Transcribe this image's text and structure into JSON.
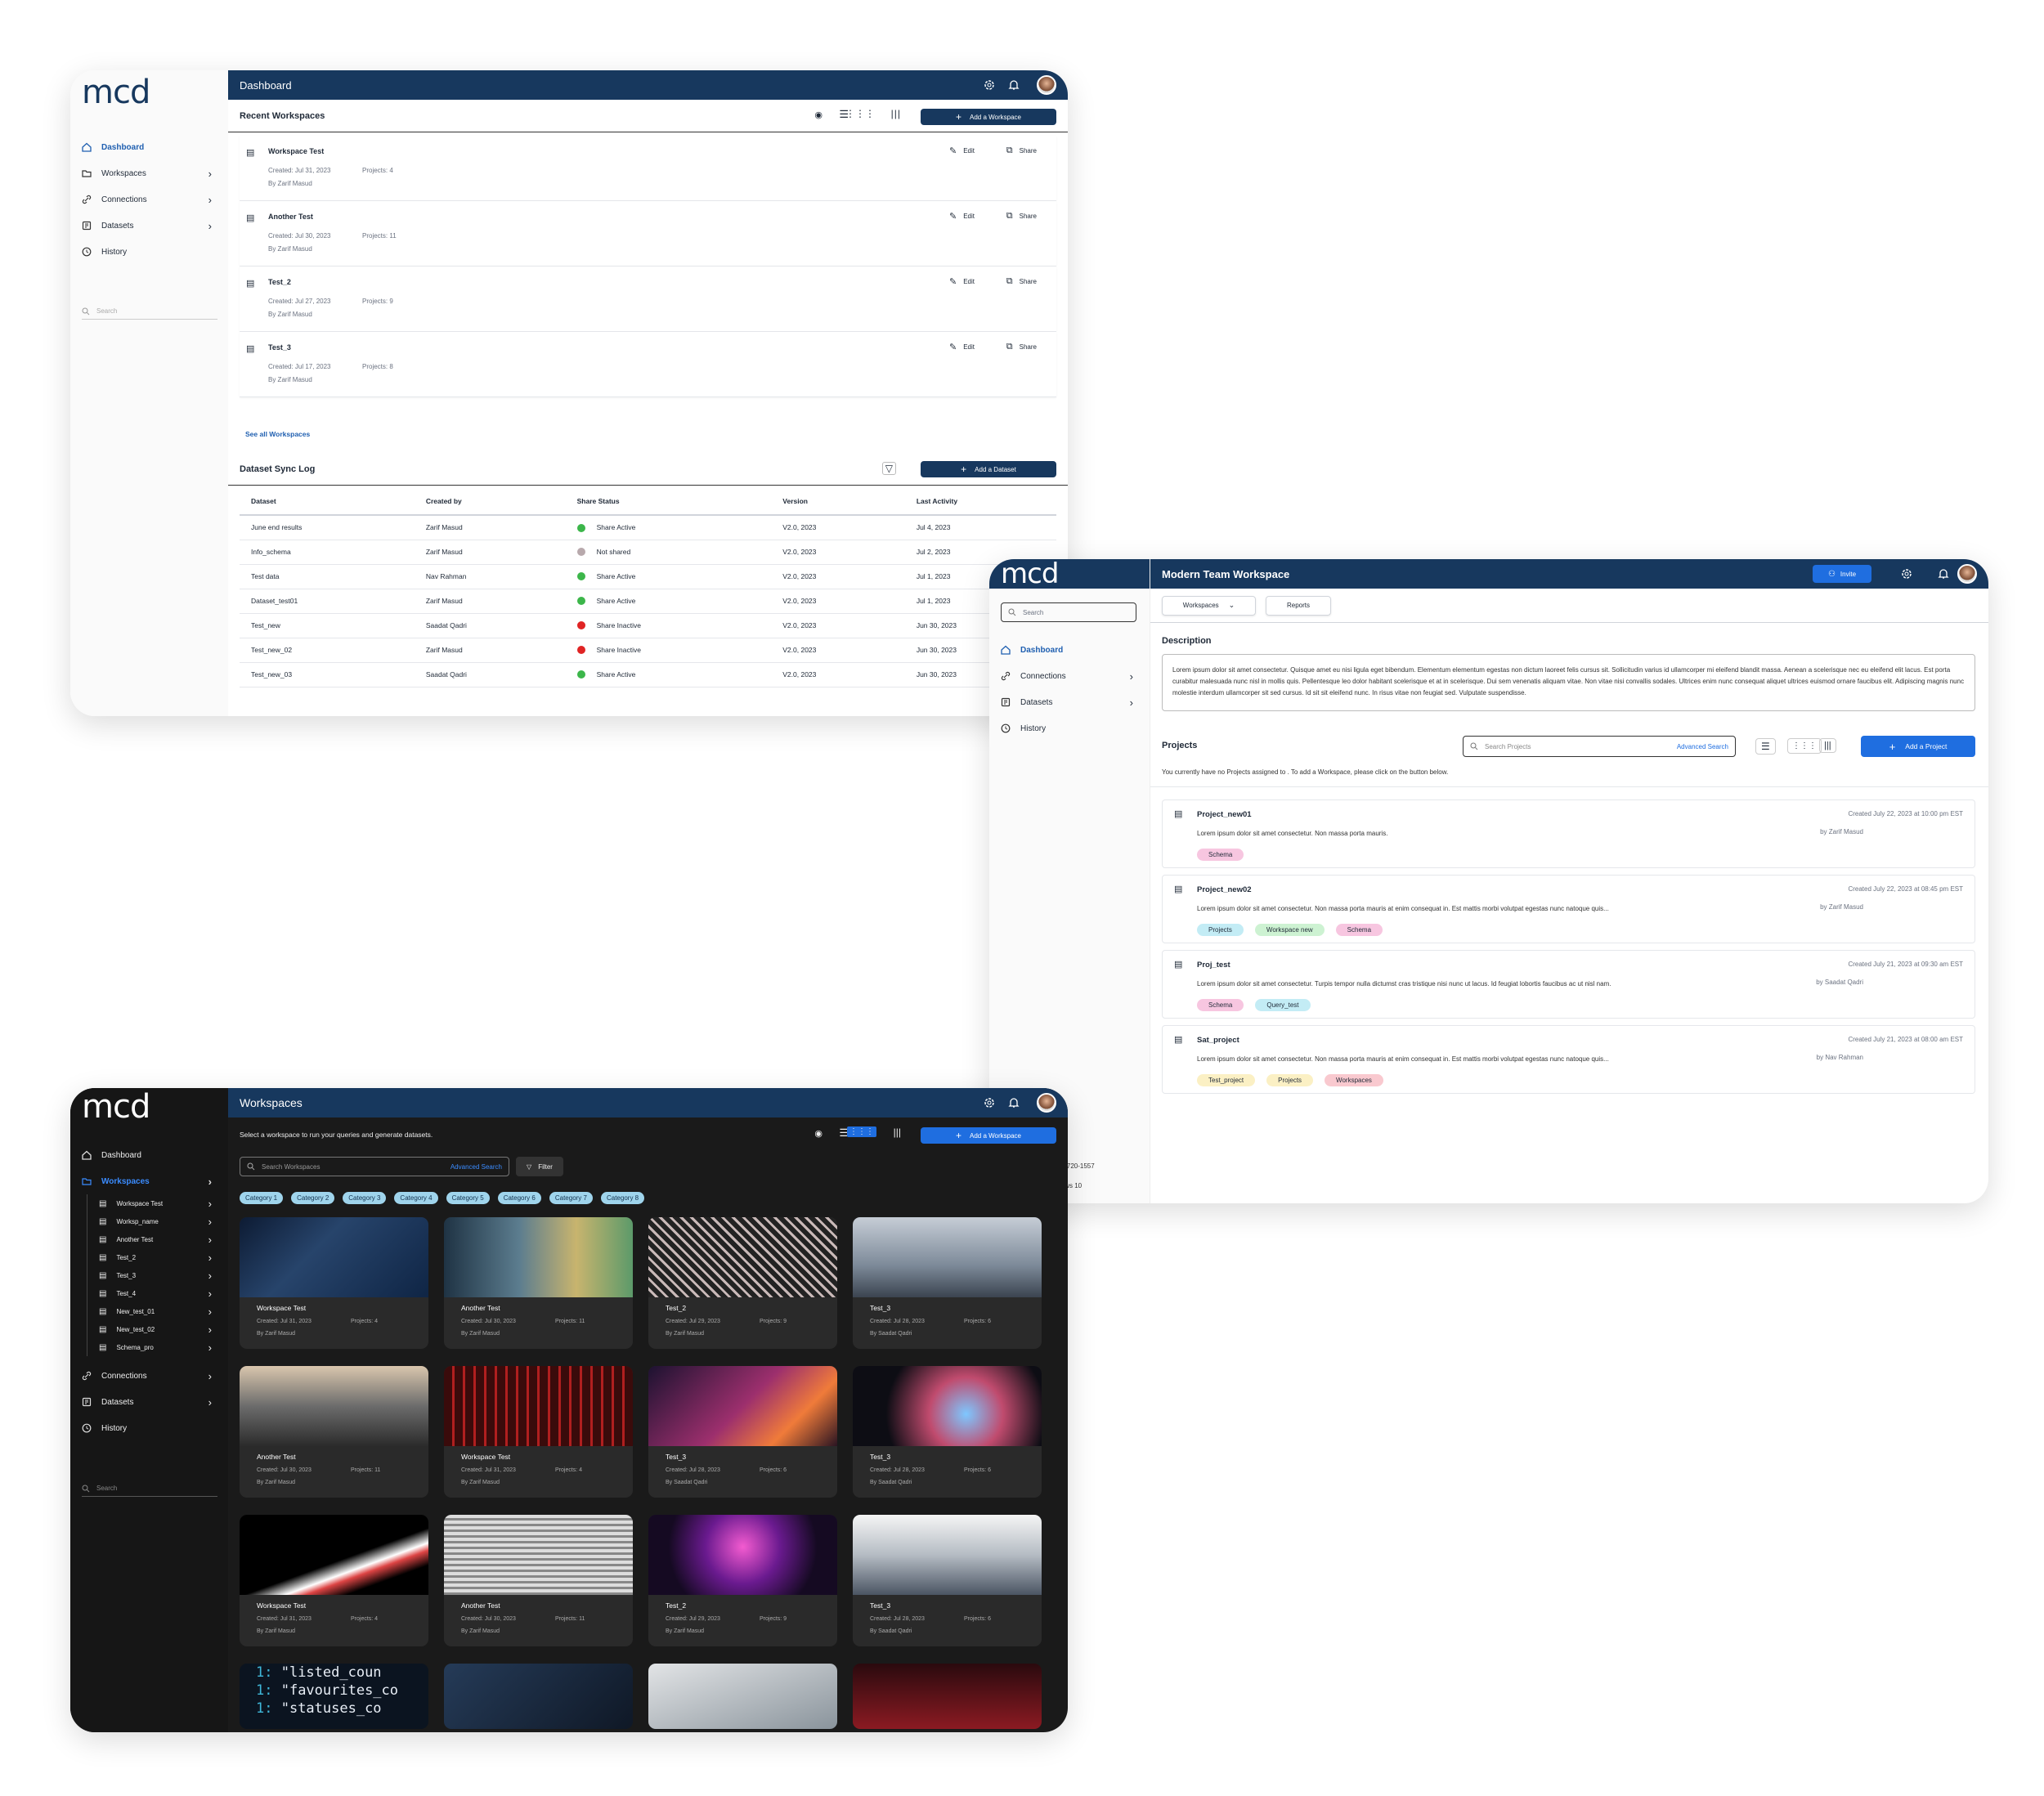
{
  "brand": {
    "logo": "mcd"
  },
  "w1": {
    "title": "Dashboard",
    "nav": [
      {
        "label": "Dashboard"
      },
      {
        "label": "Workspaces"
      },
      {
        "label": "Connections"
      },
      {
        "label": "Datasets"
      },
      {
        "label": "History"
      }
    ],
    "search_placeholder": "Search",
    "recent_title": "Recent Workspaces",
    "add_workspace": "Add a Workspace",
    "edit": "Edit",
    "share": "Share",
    "workspaces": [
      {
        "name": "Workspace Test",
        "created": "Created: Jul 31, 2023",
        "projects": "Projects: 4",
        "by": "By Zarif Masud"
      },
      {
        "name": "Another Test",
        "created": "Created: Jul 30, 2023",
        "projects": "Projects: 11",
        "by": "By Zarif Masud"
      },
      {
        "name": "Test_2",
        "created": "Created: Jul 27, 2023",
        "projects": "Projects: 9",
        "by": "By Zarif Masud"
      },
      {
        "name": "Test_3",
        "created": "Created: Jul 17, 2023",
        "projects": "Projects: 8",
        "by": "By Zarif Masud"
      }
    ],
    "see_all": "See all Workspaces",
    "sync_title": "Dataset Sync Log",
    "add_dataset": "Add a Dataset",
    "columns": [
      "Dataset",
      "Created by",
      "Share Status",
      "Version",
      "Last Activity"
    ],
    "rows": [
      {
        "dataset": "June end results",
        "by": "Zarif Masud",
        "status": "Share Active",
        "color": "#3cb64a",
        "version": "V2.0, 2023",
        "activity": "Jul 4, 2023"
      },
      {
        "dataset": "Info_schema",
        "by": "Zarif Masud",
        "status": "Not shared",
        "color": "#b8a9ac",
        "version": "V2.0, 2023",
        "activity": "Jul 2, 2023"
      },
      {
        "dataset": "Test data",
        "by": "Nav Rahman",
        "status": "Share Active",
        "color": "#3cb64a",
        "version": "V2.0, 2023",
        "activity": "Jul 1, 2023"
      },
      {
        "dataset": "Dataset_test01",
        "by": "Zarif Masud",
        "status": "Share Active",
        "color": "#3cb64a",
        "version": "V2.0, 2023",
        "activity": "Jul 1, 2023"
      },
      {
        "dataset": "Test_new",
        "by": "Saadat Qadri",
        "status": "Share Inactive",
        "color": "#e02424",
        "version": "V2.0, 2023",
        "activity": "Jun 30, 2023"
      },
      {
        "dataset": "Test_new_02",
        "by": "Zarif Masud",
        "status": "Share Inactive",
        "color": "#e02424",
        "version": "V2.0, 2023",
        "activity": "Jun 30, 2023"
      },
      {
        "dataset": "Test_new_03",
        "by": "Saadat Qadri",
        "status": "Share Active",
        "color": "#3cb64a",
        "version": "V2.0, 2023",
        "activity": "Jun 30, 2023"
      }
    ]
  },
  "w2": {
    "title": "Modern Team Workspace",
    "invite": "Invite",
    "search_placeholder": "Search",
    "nav": [
      {
        "label": "Dashboard"
      },
      {
        "label": "Connections"
      },
      {
        "label": "Datasets"
      },
      {
        "label": "History"
      }
    ],
    "tabs": [
      "Workspaces",
      "Reports"
    ],
    "description_title": "Description",
    "description": "Lorem ipsum dolor sit amet consectetur. Quisque amet eu nisi ligula eget bibendum. Elementum elementum egestas non dictum laoreet felis cursus sit. Sollicitudin varius id ullamcorper mi eleifend blandit massa. Aenean a scelerisque nec eu eleifend elit lacus. Est porta curabitur malesuada nunc nisl in mollis quis. Pellentesque leo dolor habitant scelerisque et at in scelerisque. Dui sem venenatis aliquam vitae. Non vitae nisi convallis sodales. Ultrices enim nunc consequat aliquet ultrices euismod ornare faucibus elit. Adipiscing magnis nunc molestie interdum ullamcorper sit sed cursus. Id sit sit eleifend nunc. In risus vitae non feugiat sed. Vulputate suspendisse.",
    "projects_title": "Projects",
    "search_projects": "Search Projects",
    "advanced_search": "Advanced Search",
    "add_project": "Add a Project",
    "notice": "You currently have no Projects assigned to . To add a Workspace, please click on the button below.",
    "projects": [
      {
        "name": "Project_new01",
        "desc": "Lorem ipsum dolor sit amet consectetur. Non massa porta mauris.",
        "created": "Created July 22, 2023 at 10:00 pm EST",
        "by": "by Zarif Masud",
        "tags": [
          {
            "t": "Schema",
            "c": "#f7c6e0"
          }
        ]
      },
      {
        "name": "Project_new02",
        "desc": "Lorem ipsum dolor sit amet consectetur. Non massa porta mauris at enim consequat in. Est mattis morbi volutpat egestas nunc natoque quis...",
        "created": "Created July 22, 2023 at 08:45 pm EST",
        "by": "by Zarif Masud",
        "tags": [
          {
            "t": "Projects",
            "c": "#c3ecf5"
          },
          {
            "t": "Workspace new",
            "c": "#cdf2d2"
          },
          {
            "t": "Schema",
            "c": "#f7c6e0"
          }
        ]
      },
      {
        "name": "Proj_test",
        "desc": "Lorem ipsum dolor sit amet consectetur. Turpis tempor nulla dictumst cras tristique nisi nunc ut lacus. Id feugiat lobortis faucibus ac ut nisl nam.",
        "created": "Created July 21, 2023 at 09:30 am EST",
        "by": "by Saadat Qadri",
        "tags": [
          {
            "t": "Schema",
            "c": "#f7c6e0"
          },
          {
            "t": "Query_test",
            "c": "#c3ecf5"
          }
        ]
      },
      {
        "name": "Sat_project",
        "desc": "Lorem ipsum dolor sit amet consectetur. Non massa porta mauris at enim consequat in. Est mattis morbi volutpat egestas nunc natoque quis...",
        "created": "Created July 21, 2023 at 08:00 am EST",
        "by": "by Nav Rahman",
        "tags": [
          {
            "t": "Test_project",
            "c": "#fbf0c4"
          },
          {
            "t": "Projects",
            "c": "#fbf0c4"
          },
          {
            "t": "Workspaces",
            "c": "#f9c9cf"
          }
        ]
      }
    ],
    "peek1": "30720-1557",
    "peek2": "lows 10"
  },
  "w3": {
    "title": "Workspaces",
    "subtitle": "Select a workspace to run your queries and generate datasets.",
    "add_workspace": "Add a Workspace",
    "search_placeholder": "Search Workspaces",
    "advanced_search": "Advanced Search",
    "filter": "Filter",
    "categories": [
      "Category 1",
      "Category 2",
      "Category 3",
      "Category 4",
      "Category 5",
      "Category 6",
      "Category 7",
      "Category 8"
    ],
    "nav_top": [
      {
        "label": "Dashboard"
      },
      {
        "label": "Workspaces"
      }
    ],
    "sub_items": [
      "Workspace Test",
      "Worksp_name",
      "Another Test",
      "Test_2",
      "Test_3",
      "Test_4",
      "New_test_01",
      "New_test_02",
      "Schema_pro"
    ],
    "nav_bottom": [
      {
        "label": "Connections"
      },
      {
        "label": "Datasets"
      },
      {
        "label": "History"
      }
    ],
    "search_side": "Search",
    "cards": [
      {
        "name": "Workspace Test",
        "created": "Created: Jul 31, 2023",
        "projects": "Projects: 4",
        "by": "By Zarif Masud",
        "bg": "linear-gradient(135deg,#0d1b33,#27446b 40%,#0f2545)"
      },
      {
        "name": "Another Test",
        "created": "Created: Jul 30, 2023",
        "projects": "Projects: 11",
        "by": "By Zarif Masud",
        "bg": "linear-gradient(90deg,#1f3344,#5c7d8f 40%,#c8b46e 70%,#5c9a6a)"
      },
      {
        "name": "Test_2",
        "created": "Created: Jul 29, 2023",
        "projects": "Projects: 9",
        "by": "By Zarif Masud",
        "bg": "repeating-linear-gradient(45deg,#222 0 6px,#c9b9b8 6px 9px)"
      },
      {
        "name": "Test_3",
        "created": "Created: Jul 28, 2023",
        "projects": "Projects: 6",
        "by": "By Saadat Qadri",
        "bg": "linear-gradient(180deg,#c6cdd6,#7d8a99 60%,#3b4450)"
      },
      {
        "name": "Another Test",
        "created": "Created: Jul 30, 2023",
        "projects": "Projects: 11",
        "by": "By Zarif Masud",
        "bg": "linear-gradient(180deg,#d9c6ad,#6c6c6c 50%,#2b2b2b)"
      },
      {
        "name": "Workspace Test",
        "created": "Created: Jul 31, 2023",
        "projects": "Projects: 4",
        "by": "By Zarif Masud",
        "bg": "repeating-linear-gradient(90deg,#3a0b0b 0 10px,#b01f1f 10px 13px)"
      },
      {
        "name": "Test_3",
        "created": "Created: Jul 28, 2023",
        "projects": "Projects: 6",
        "by": "By Saadat Qadri",
        "bg": "linear-gradient(135deg,#1c1230,#9c2f6d 50%,#f07b3a 75%,#2a1422)"
      },
      {
        "name": "Test_3",
        "created": "Created: Jul 28, 2023",
        "projects": "Projects: 6",
        "by": "By Saadat Qadri",
        "bg": "radial-gradient(circle at 60% 60%,#7ec7ff,#c04b6e 30%,#0d0d14 65%)"
      },
      {
        "name": "Workspace Test",
        "created": "Created: Jul 31, 2023",
        "projects": "Projects: 4",
        "by": "By Zarif Masud",
        "bg": "linear-gradient(160deg,#000 55%,#fff 65%,#d44 70%,#000 80%)"
      },
      {
        "name": "Another Test",
        "created": "Created: Jul 30, 2023",
        "projects": "Projects: 11",
        "by": "By Zarif Masud",
        "bg": "repeating-linear-gradient(0deg,#888 0 3px,#ddd 3px 7px)"
      },
      {
        "name": "Test_2",
        "created": "Created: Jul 29, 2023",
        "projects": "Projects: 9",
        "by": "By Zarif Masud",
        "bg": "radial-gradient(circle at 50% 40%,#f35bd0,#6a1a8f 35%,#150a22 70%)"
      },
      {
        "name": "Test_3",
        "created": "Created: Jul 28, 2023",
        "projects": "Projects: 6",
        "by": "By Saadat Qadri",
        "bg": "linear-gradient(180deg,#f5f5f5,#b5bcc4 50%,#4b5563)"
      }
    ],
    "peek_code": [
      "\"listed_coun",
      "\"favourites_co",
      "\"statuses_co"
    ],
    "peek_bgs": [
      "#0b1420",
      "linear-gradient(135deg,#253b58,#0f1826)",
      "linear-gradient(160deg,#e2e4e6,#8a949c)",
      "linear-gradient(180deg,#2a0a0e,#8b1a22)"
    ]
  }
}
